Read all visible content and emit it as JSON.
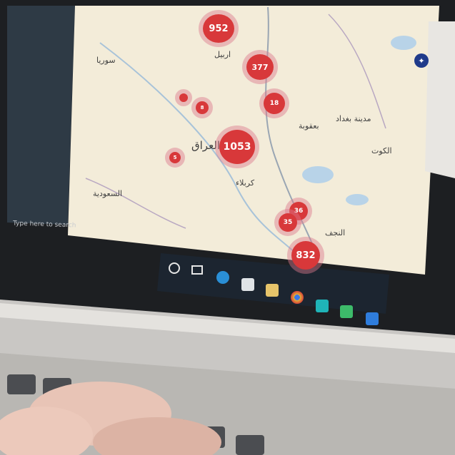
{
  "map": {
    "country_label": "العراق",
    "city_labels": [
      "اربيل",
      "بعقوبة",
      "مدينة بغداد",
      "كربلاء",
      "النجف",
      "الكوت"
    ],
    "region_labels": [
      "سوريا",
      "السعودية"
    ],
    "clusters": [
      {
        "count": "952"
      },
      {
        "count": "377"
      },
      {
        "count": "18"
      },
      {
        "count": "8"
      },
      {
        "count": ""
      },
      {
        "count": "1053"
      },
      {
        "count": "5"
      },
      {
        "count": "36"
      },
      {
        "count": "35"
      },
      {
        "count": "832"
      }
    ]
  },
  "taskbar": {
    "search_placeholder": "Type here to search"
  },
  "colors": {
    "cluster": "#d8383a",
    "map_land": "#f3ecd9",
    "taskbar": "#1c2530"
  }
}
